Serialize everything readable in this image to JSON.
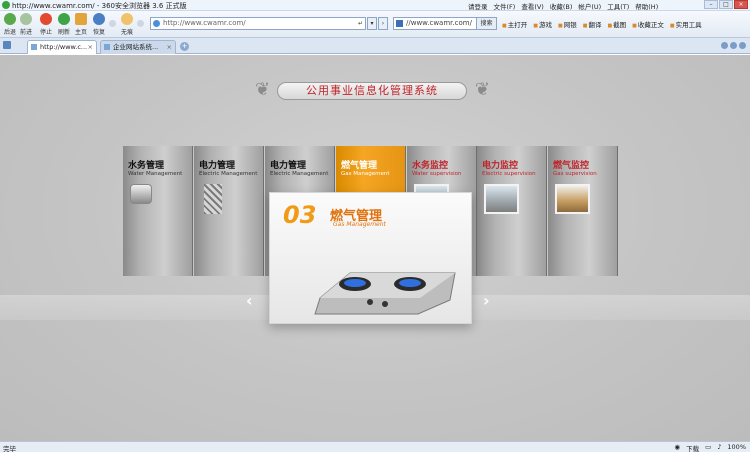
{
  "window": {
    "title": "http://www.cwamr.com/ - 360安全浏览器 3.6 正式版",
    "menu": [
      "请登录",
      "文件(F)",
      "查看(V)",
      "收藏(B)",
      "帐户(U)",
      "工具(T)",
      "帮助(H)"
    ]
  },
  "toolbar": {
    "back": "后退",
    "forward": "前进",
    "stop": "停止",
    "refresh": "刷新",
    "home": "主页",
    "restore": "恢复",
    "trace": "无痕",
    "address": "http://www.cwamr.com/",
    "search_value": "//www.cwamr.com/",
    "search_button": "搜索",
    "tools": [
      "主打开",
      "游戏",
      "网银",
      "翻译",
      "截图",
      "收藏正文",
      "实用工具"
    ]
  },
  "tabs": [
    {
      "label": "http://www.c..."
    },
    {
      "label": "企业网站系统..."
    }
  ],
  "content": {
    "banner": "公用事业信息化管理系统",
    "panels": [
      {
        "cn": "水务管理",
        "en": "Water Management"
      },
      {
        "cn": "电力管理",
        "en": "Electric Management"
      },
      {
        "cn": "电力管理",
        "en": "Electric Management"
      },
      {
        "cn": "燃气管理",
        "en": "Gas Management"
      },
      {
        "cn": "水务监控",
        "en": "Water supervision"
      },
      {
        "cn": "电力监控",
        "en": "Electric supervision"
      },
      {
        "cn": "燃气监控",
        "en": "Gas supervision"
      }
    ],
    "card": {
      "number": "03",
      "cn": "燃气管理",
      "en": "Gas Management"
    },
    "prev_arrow": "‹",
    "next_arrow": "›"
  },
  "status": {
    "left": "完毕",
    "download": "下载",
    "zoom": "100%"
  },
  "colors": {
    "accent_orange": "#f09a16",
    "title_red": "#c0242a"
  }
}
